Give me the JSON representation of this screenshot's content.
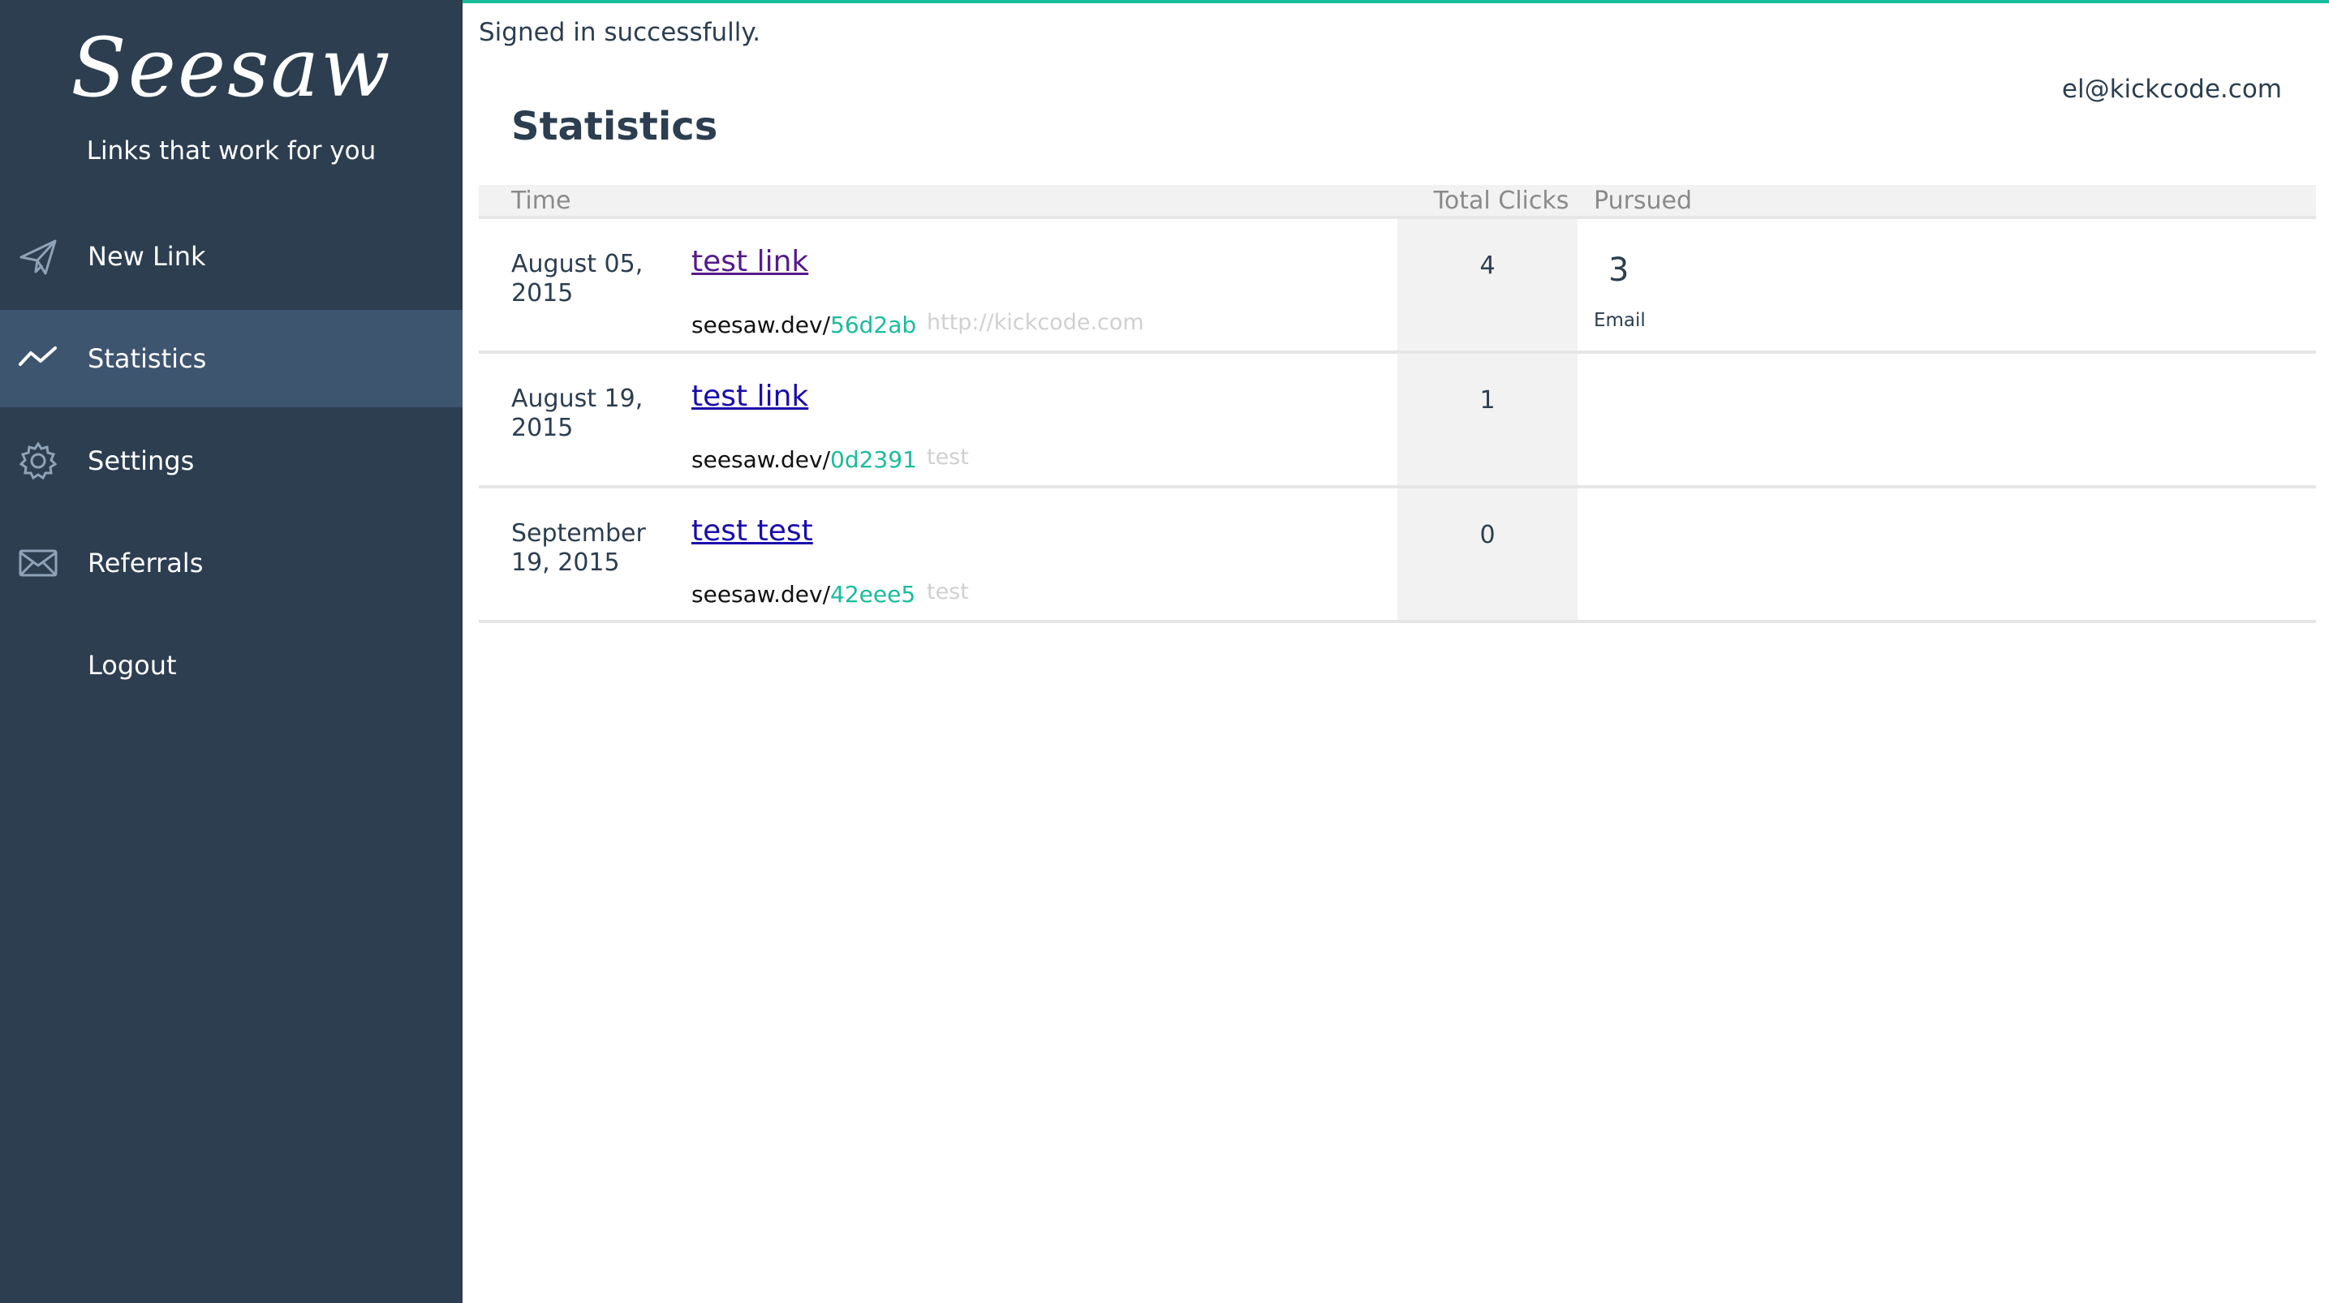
{
  "brand": {
    "logo_text": "Seesaw",
    "tagline": "Links that work for you"
  },
  "sidebar": {
    "items": [
      {
        "label": "New Link",
        "icon": "paper-plane-icon",
        "active": false
      },
      {
        "label": "Statistics",
        "icon": "trend-line-icon",
        "active": true
      },
      {
        "label": "Settings",
        "icon": "gear-icon",
        "active": false
      },
      {
        "label": "Referrals",
        "icon": "envelope-icon",
        "active": false
      },
      {
        "label": "Logout",
        "icon": "",
        "active": false
      }
    ]
  },
  "flash": "Signed in successfully.",
  "user": {
    "email": "el@kickcode.com"
  },
  "page": {
    "title": "Statistics"
  },
  "table": {
    "headers": {
      "time": "Time",
      "total_clicks": "Total Clicks",
      "pursued": "Pursued"
    },
    "rows": [
      {
        "date": "August 05, 2015",
        "title": "test link",
        "short_prefix": "seesaw.dev/",
        "slug": "56d2ab",
        "destination": "http://kickcode.com",
        "clicks": "4",
        "pursued_count": "3",
        "pursued_label": "Email"
      },
      {
        "date": "August 19, 2015",
        "title": "test link",
        "short_prefix": "seesaw.dev/",
        "slug": "0d2391",
        "destination": "test",
        "clicks": "1",
        "pursued_count": "",
        "pursued_label": ""
      },
      {
        "date": "September 19, 2015",
        "title": "test test",
        "short_prefix": "seesaw.dev/",
        "slug": "42eee5",
        "destination": "test",
        "clicks": "0",
        "pursued_count": "",
        "pursued_label": ""
      }
    ]
  },
  "colors": {
    "sidebar_bg": "#2c3e50",
    "sidebar_active": "#3e5570",
    "accent": "#1abc9c",
    "link": "#1a0dab",
    "link_visited": "#551a8b"
  }
}
